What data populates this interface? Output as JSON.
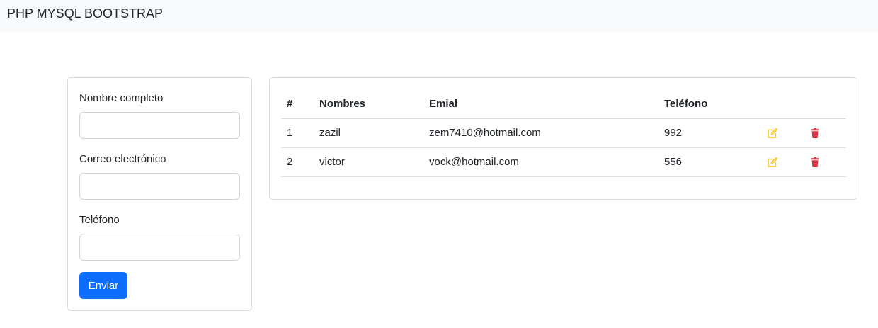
{
  "app": {
    "brand": "PHP MYSQL BOOTSTRAP"
  },
  "form": {
    "fields": [
      {
        "label": "Nombre completo",
        "value": "",
        "placeholder": ""
      },
      {
        "label": "Correo electrónico",
        "value": "",
        "placeholder": ""
      },
      {
        "label": "Teléfono",
        "value": "",
        "placeholder": ""
      }
    ],
    "submit_label": "Enviar"
  },
  "table": {
    "headers": [
      "#",
      "Nombres",
      "Emial",
      "Teléfono"
    ],
    "rows": [
      {
        "num": "1",
        "name": "zazil",
        "email": "zem7410@hotmail.com",
        "phone": "992"
      },
      {
        "num": "2",
        "name": "victor",
        "email": "vock@hotmail.com",
        "phone": "556"
      }
    ]
  },
  "icons": {
    "edit": "edit-icon",
    "delete": "trash-icon"
  },
  "colors": {
    "primary": "#0d6efd",
    "edit": "#ffc107",
    "delete": "#dc3545",
    "navbar": "#f8f9fa"
  }
}
